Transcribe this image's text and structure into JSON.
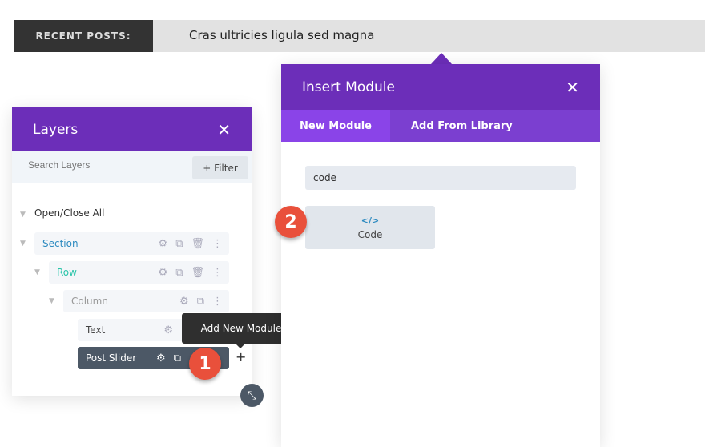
{
  "topbar": {
    "label": "RECENT POSTS:",
    "title": "Cras ultricies ligula sed magna"
  },
  "layers": {
    "title": "Layers",
    "search_placeholder": "Search Layers",
    "filter_label": "+ Filter",
    "open_close": "Open/Close All",
    "items": [
      {
        "label": "Section",
        "color": "#2e8bc0"
      },
      {
        "label": "Row",
        "color": "#29c4a9"
      },
      {
        "label": "Column",
        "color": "#999"
      },
      {
        "label": "Text",
        "color": "#444"
      },
      {
        "label": "Post Slider",
        "color": "#fff"
      }
    ]
  },
  "tooltip": "Add New Module",
  "badges": [
    "1",
    "2"
  ],
  "insert": {
    "title": "Insert Module",
    "tabs": [
      "New Module",
      "Add From Library"
    ],
    "search_value": "code",
    "module": {
      "icon": "</>",
      "label": "Code"
    }
  },
  "colors": {
    "purple": "#6c2eb9",
    "tab": "#7b3fd0",
    "active_tab": "#8a44e8",
    "badge": "#e9503b"
  }
}
